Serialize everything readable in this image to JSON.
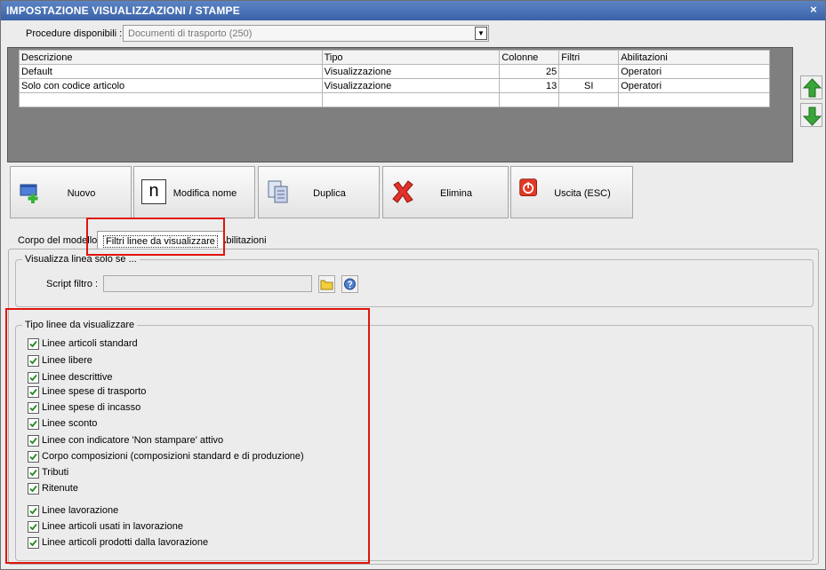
{
  "window": {
    "title": "IMPOSTAZIONE VISUALIZZAZIONI / STAMPE",
    "close": "×"
  },
  "procedure": {
    "label": "Procedure disponibili :",
    "value": "Documenti di trasporto (250)"
  },
  "grid": {
    "columns": [
      "Descrizione",
      "Tipo",
      "Colonne",
      "Filtri",
      "Abilitazioni"
    ],
    "rows": [
      [
        "Default",
        "Visualizzazione",
        "25",
        "",
        "Operatori"
      ],
      [
        "Solo con codice articolo",
        "Visualizzazione",
        "13",
        "SI",
        "Operatori"
      ],
      [
        "",
        "",
        "",
        "",
        ""
      ]
    ]
  },
  "toolbar": {
    "new_label": "Nuovo",
    "rename_label": "Modifica nome",
    "rename_icon_letter": "n",
    "duplicate_label": "Duplica",
    "delete_label": "Elimina",
    "exit_label": "Uscita (ESC)"
  },
  "tabs": [
    "Corpo del modello",
    "Filtri linee da visualizzare",
    "Abilitazioni"
  ],
  "filter_group": {
    "title": "Visualizza linea solo se ...",
    "script_label": "Script filtro :",
    "script_value": ""
  },
  "line_types": {
    "title": "Tipo linee da visualizzare",
    "items": [
      {
        "label": "Linee articoli standard",
        "checked": true
      },
      {
        "label": "Linee libere",
        "checked": true
      },
      {
        "label": "Linee descrittive",
        "checked": true
      },
      {
        "label": "Linee spese di trasporto",
        "checked": true
      },
      {
        "label": "Linee spese di incasso",
        "checked": true
      },
      {
        "label": "Linee sconto",
        "checked": true
      },
      {
        "label": "Linee con indicatore 'Non stampare' attivo",
        "checked": true
      },
      {
        "label": "Corpo composizioni (composizioni standard e di produzione)",
        "checked": true
      },
      {
        "label": "Tributi",
        "checked": true
      },
      {
        "label": "Ritenute",
        "checked": true
      },
      {
        "label": "Linee lavorazione",
        "checked": true
      },
      {
        "label": "Linee articoli usati in lavorazione",
        "checked": true
      },
      {
        "label": "Linee articoli prodotti dalla lavorazione",
        "checked": true
      }
    ]
  },
  "colors": {
    "title_bar": "#3a62a8",
    "highlight": "#e0140e",
    "arrow": "#3aa53a"
  }
}
